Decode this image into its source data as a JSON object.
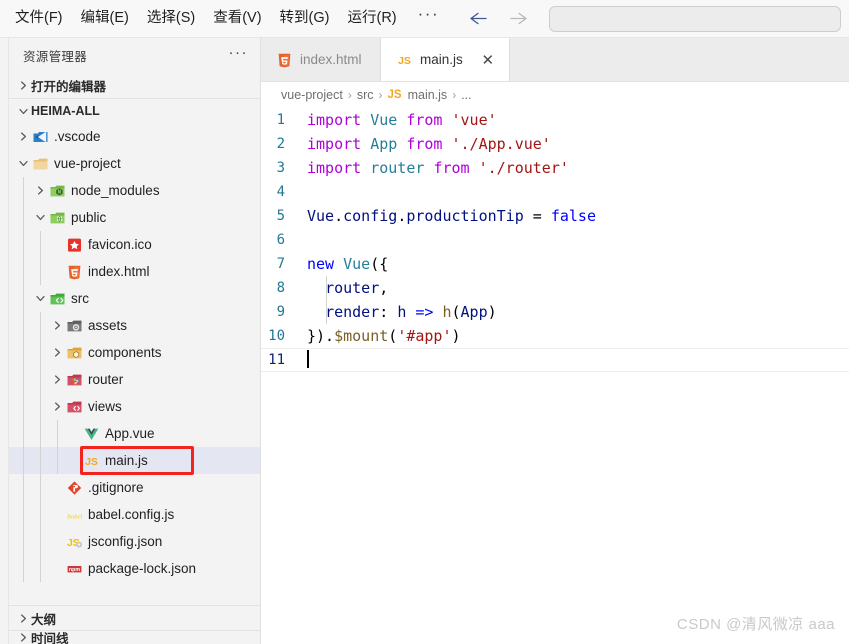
{
  "titlebar": {
    "menus": [
      {
        "label": "文件(F)",
        "name": "menu-file"
      },
      {
        "label": "编辑(E)",
        "name": "menu-edit"
      },
      {
        "label": "选择(S)",
        "name": "menu-selection"
      },
      {
        "label": "查看(V)",
        "name": "menu-view"
      },
      {
        "label": "转到(G)",
        "name": "menu-go"
      },
      {
        "label": "运行(R)",
        "name": "menu-run"
      }
    ],
    "overflow_label": "···",
    "back_icon": "arrow-left-icon",
    "forward_icon": "arrow-right-icon",
    "search_value": "",
    "search_placeholder": ""
  },
  "sidebar": {
    "title": "资源管理器",
    "actions_label": "···",
    "open_editors_label": "打开的编辑器",
    "root_label": "HEIMA-ALL",
    "outline_label": "大纲",
    "timeline_label": "时间线",
    "tree": [
      {
        "label": ".vscode",
        "icon": "vscode-folder-icon",
        "depth": 1,
        "type": "folder",
        "expanded": false,
        "selected": false
      },
      {
        "label": "vue-project",
        "icon": "folder-icon",
        "depth": 1,
        "type": "folder",
        "expanded": true,
        "selected": false
      },
      {
        "label": "node_modules",
        "icon": "node-folder-icon",
        "depth": 2,
        "type": "folder",
        "expanded": false,
        "selected": false
      },
      {
        "label": "public",
        "icon": "public-folder-icon",
        "depth": 2,
        "type": "folder",
        "expanded": true,
        "selected": false
      },
      {
        "label": "favicon.ico",
        "icon": "favicon-icon",
        "depth": 3,
        "type": "file",
        "expanded": null,
        "selected": false
      },
      {
        "label": "index.html",
        "icon": "html5-icon",
        "depth": 3,
        "type": "file",
        "expanded": null,
        "selected": false
      },
      {
        "label": "src",
        "icon": "src-folder-icon",
        "depth": 2,
        "type": "folder",
        "expanded": true,
        "selected": false
      },
      {
        "label": "assets",
        "icon": "assets-folder-icon",
        "depth": 3,
        "type": "folder",
        "expanded": false,
        "selected": false
      },
      {
        "label": "components",
        "icon": "components-folder-icon",
        "depth": 3,
        "type": "folder",
        "expanded": false,
        "selected": false
      },
      {
        "label": "router",
        "icon": "router-folder-icon",
        "depth": 3,
        "type": "folder",
        "expanded": false,
        "selected": false
      },
      {
        "label": "views",
        "icon": "views-folder-icon",
        "depth": 3,
        "type": "folder",
        "expanded": false,
        "selected": false
      },
      {
        "label": "App.vue",
        "icon": "vue-icon",
        "depth": 4,
        "type": "file",
        "expanded": null,
        "selected": false
      },
      {
        "label": "main.js",
        "icon": "js-icon",
        "depth": 4,
        "type": "file",
        "expanded": null,
        "selected": true,
        "annotated": true
      },
      {
        "label": ".gitignore",
        "icon": "git-icon",
        "depth": 3,
        "type": "file",
        "expanded": null,
        "selected": false
      },
      {
        "label": "babel.config.js",
        "icon": "babel-icon",
        "depth": 3,
        "type": "file",
        "expanded": null,
        "selected": false
      },
      {
        "label": "jsconfig.json",
        "icon": "jsconfig-icon",
        "depth": 3,
        "type": "file",
        "expanded": null,
        "selected": false
      },
      {
        "label": "package-lock.json",
        "icon": "npm-icon",
        "depth": 3,
        "type": "file",
        "expanded": null,
        "selected": false
      }
    ]
  },
  "editor": {
    "tabs": [
      {
        "label": "index.html",
        "icon": "html5-icon",
        "active": false,
        "closable": false
      },
      {
        "label": "main.js",
        "icon": "js-icon",
        "active": true,
        "closable": true
      }
    ],
    "close_icon": "close-icon",
    "breadcrumb": {
      "items": [
        "vue-project",
        "src",
        "main.js",
        "..."
      ],
      "separator": "›",
      "file_badge": "JS"
    },
    "js_badge": "JS",
    "cursor_line": 11,
    "lines": [
      {
        "n": 1,
        "tokens": [
          {
            "t": "import",
            "c": "kw"
          },
          {
            "t": " ",
            "c": "plain"
          },
          {
            "t": "Vue",
            "c": "type"
          },
          {
            "t": " ",
            "c": "plain"
          },
          {
            "t": "from",
            "c": "kw"
          },
          {
            "t": " ",
            "c": "plain"
          },
          {
            "t": "'vue'",
            "c": "str"
          }
        ]
      },
      {
        "n": 2,
        "tokens": [
          {
            "t": "import",
            "c": "kw"
          },
          {
            "t": " ",
            "c": "plain"
          },
          {
            "t": "App",
            "c": "type"
          },
          {
            "t": " ",
            "c": "plain"
          },
          {
            "t": "from",
            "c": "kw"
          },
          {
            "t": " ",
            "c": "plain"
          },
          {
            "t": "'./App.vue'",
            "c": "str"
          }
        ]
      },
      {
        "n": 3,
        "tokens": [
          {
            "t": "import",
            "c": "kw"
          },
          {
            "t": " ",
            "c": "plain"
          },
          {
            "t": "router",
            "c": "type"
          },
          {
            "t": " ",
            "c": "plain"
          },
          {
            "t": "from",
            "c": "kw"
          },
          {
            "t": " ",
            "c": "plain"
          },
          {
            "t": "'./router'",
            "c": "str"
          }
        ]
      },
      {
        "n": 4,
        "tokens": []
      },
      {
        "n": 5,
        "tokens": [
          {
            "t": "Vue",
            "c": "var"
          },
          {
            "t": ".",
            "c": "plain"
          },
          {
            "t": "config",
            "c": "var"
          },
          {
            "t": ".",
            "c": "plain"
          },
          {
            "t": "productionTip",
            "c": "var"
          },
          {
            "t": " = ",
            "c": "plain"
          },
          {
            "t": "false",
            "c": "blue"
          }
        ]
      },
      {
        "n": 6,
        "tokens": []
      },
      {
        "n": 7,
        "tokens": [
          {
            "t": "new",
            "c": "blue"
          },
          {
            "t": " ",
            "c": "plain"
          },
          {
            "t": "Vue",
            "c": "type"
          },
          {
            "t": "({",
            "c": "plain"
          }
        ]
      },
      {
        "n": 8,
        "tokens": [
          {
            "t": "  ",
            "c": "plain"
          },
          {
            "t": "router",
            "c": "var"
          },
          {
            "t": ",",
            "c": "plain"
          }
        ]
      },
      {
        "n": 9,
        "tokens": [
          {
            "t": "  ",
            "c": "plain"
          },
          {
            "t": "render",
            "c": "var"
          },
          {
            "t": ": ",
            "c": "plain"
          },
          {
            "t": "h",
            "c": "var"
          },
          {
            "t": " ",
            "c": "plain"
          },
          {
            "t": "=>",
            "c": "blue"
          },
          {
            "t": " ",
            "c": "plain"
          },
          {
            "t": "h",
            "c": "fn"
          },
          {
            "t": "(",
            "c": "plain"
          },
          {
            "t": "App",
            "c": "var"
          },
          {
            "t": ")",
            "c": "plain"
          }
        ]
      },
      {
        "n": 10,
        "tokens": [
          {
            "t": "}).",
            "c": "plain"
          },
          {
            "t": "$mount",
            "c": "fn"
          },
          {
            "t": "(",
            "c": "plain"
          },
          {
            "t": "'#app'",
            "c": "str"
          },
          {
            "t": ")",
            "c": "plain"
          }
        ]
      },
      {
        "n": 11,
        "tokens": []
      }
    ]
  },
  "watermark": "CSDN @清风微凉 aaa",
  "colors": {
    "accent_red": "#f5231f",
    "selection": "#e4e6f1",
    "keyword": "#af00db",
    "type": "#267f99",
    "string": "#a31515",
    "linenum": "#237893",
    "js_yellow": "#f5a623"
  }
}
